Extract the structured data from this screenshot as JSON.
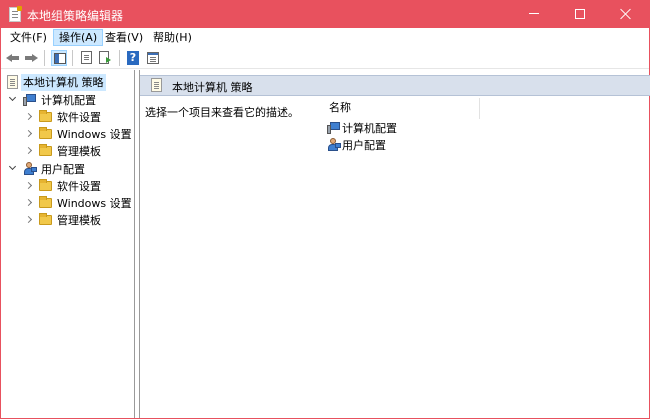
{
  "window": {
    "title": "本地组策略编辑器",
    "accent_color": "#e8515e"
  },
  "menubar": {
    "items": [
      {
        "label": "文件(F)"
      },
      {
        "label": "操作(A)",
        "active": true
      },
      {
        "label": "查看(V)"
      },
      {
        "label": "帮助(H)"
      }
    ]
  },
  "toolbar": {
    "buttons": [
      {
        "icon": "back-arrow-icon"
      },
      {
        "icon": "forward-arrow-icon"
      },
      {
        "icon": "show-hide-tree-icon",
        "selected": true
      },
      {
        "icon": "properties-sheet-icon"
      },
      {
        "icon": "export-list-icon"
      },
      {
        "icon": "help-icon",
        "glyph": "?"
      },
      {
        "icon": "action-pane-icon"
      }
    ]
  },
  "tree": {
    "root": "本地计算机 策略",
    "computer": {
      "label": "计算机配置",
      "children": [
        "软件设置",
        "Windows 设置",
        "管理模板"
      ]
    },
    "user": {
      "label": "用户配置",
      "children": [
        "软件设置",
        "Windows 设置",
        "管理模板"
      ]
    }
  },
  "main": {
    "header_title": "本地计算机 策略",
    "description": "选择一个项目来查看它的描述。",
    "column_name": "名称",
    "items": [
      "计算机配置",
      "用户配置"
    ]
  }
}
